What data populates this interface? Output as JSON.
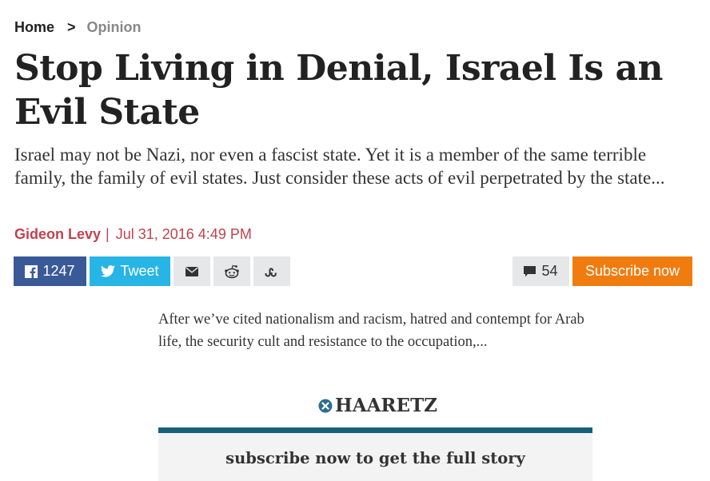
{
  "breadcrumb": {
    "home": "Home",
    "separator": ">",
    "current": "Opinion"
  },
  "article": {
    "headline": "Stop Living in Denial, Israel Is an Evil State",
    "dek": "Israel may not be Nazi, nor even a fascist state. Yet it is a member of the same terrible family, the family of evil states. Just consider these acts of evil perpetrated by the state...",
    "author": "Gideon Levy",
    "byline_separator": "|",
    "date": "Jul 31, 2016 4:49 PM",
    "excerpt": "After we’ve cited nationalism and racism, hatred and contempt for Arab life, the security cult and resistance to the occupation,..."
  },
  "share": {
    "facebook_count": "1247",
    "tweet_label": "Tweet",
    "comments_count": "54",
    "subscribe_label": "Subscribe now",
    "icons": [
      "facebook-icon",
      "twitter-icon",
      "mail-icon",
      "reddit-icon",
      "stumbleupon-icon",
      "comment-icon"
    ]
  },
  "paywall": {
    "brand": "HAARETZ",
    "message": "subscribe now to get the full story"
  },
  "colors": {
    "accent_red": "#c3424f",
    "facebook": "#3a5a97",
    "twitter": "#27b5e5",
    "subscribe": "#f07c10",
    "paywall_rule": "#17607a"
  }
}
